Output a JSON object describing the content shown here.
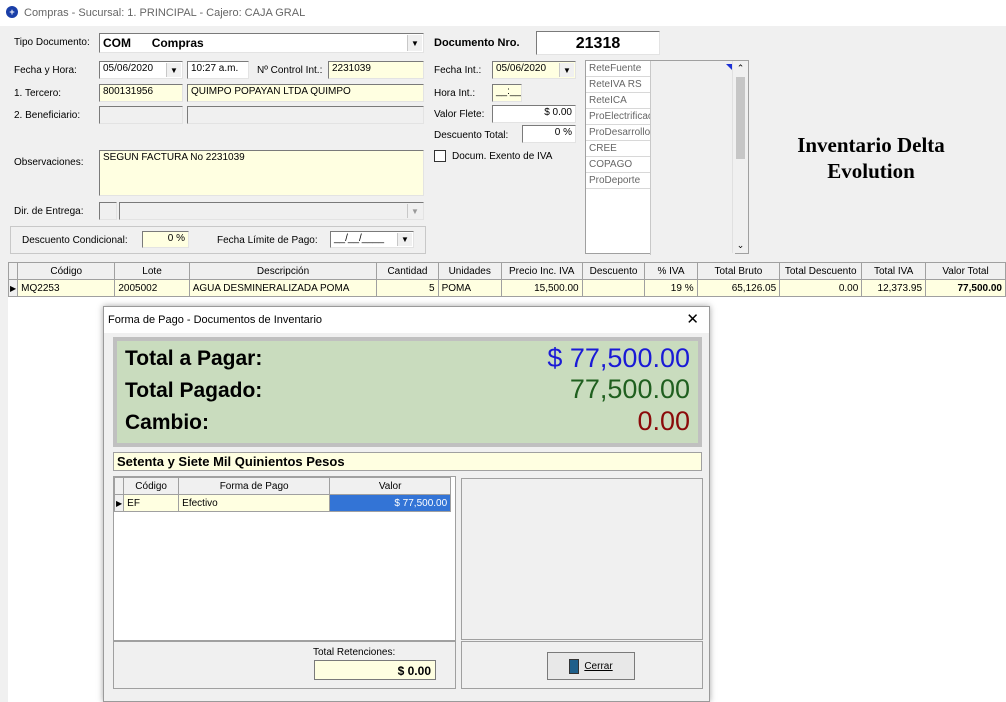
{
  "window": {
    "title": "Compras - Sucursal: 1. PRINCIPAL - Cajero: CAJA GRAL"
  },
  "form": {
    "tipo_documento_label": "Tipo Documento:",
    "tipo_documento_code": "COM",
    "tipo_documento_name": "Compras",
    "documento_nro_label": "Documento Nro.",
    "documento_nro": "21318",
    "fecha_hora_label": "Fecha y Hora:",
    "fecha": "05/06/2020",
    "hora": "10:27 a.m.",
    "control_label": "Nº Control Int.:",
    "control": "2231039",
    "tercero_label": "1. Tercero:",
    "tercero_nit": "800131956",
    "tercero_name": "QUIMPO POPAYAN LTDA QUIMPO",
    "beneficiario_label": "2. Beneficiario:",
    "observaciones_label": "Observaciones:",
    "observaciones": "SEGUN FACTURA No 2231039",
    "dir_entrega_label": "Dir. de Entrega:",
    "descuento_condicional_label": "Descuento Condicional:",
    "descuento_condicional": "0 %",
    "fecha_limite_label": "Fecha Límite de Pago:",
    "fecha_limite": "__/__/____",
    "fecha_int_label": "Fecha Int.:",
    "fecha_int": "05/06/2020",
    "hora_int_label": "Hora Int.:",
    "hora_int": "__:__",
    "valor_flete_label": "Valor Flete:",
    "valor_flete": "$ 0.00",
    "descuento_total_label": "Descuento Total:",
    "descuento_total": "0 %",
    "exento_label": "Docum. Exento de IVA"
  },
  "retenciones": [
    "ReteFuente",
    "ReteIVA RS",
    "ReteICA",
    "ProElectrificaci",
    "ProDesarrollo",
    "CREE",
    "COPAGO",
    "ProDeporte"
  ],
  "brand": {
    "line1": "Inventario Delta",
    "line2": "Evolution"
  },
  "items_grid": {
    "headers": [
      "Código",
      "Lote",
      "Descripción",
      "Cantidad",
      "Unidades",
      "Precio Inc. IVA",
      "Descuento",
      "% IVA",
      "Total Bruto",
      "Total Descuento",
      "Total IVA",
      "Valor Total"
    ],
    "rows": [
      [
        "MQ2253",
        "2005002",
        "AGUA DESMINERALIZADA POMA",
        "5",
        "POMA",
        "15,500.00",
        "",
        "19 %",
        "65,126.05",
        "0.00",
        "12,373.95",
        "77,500.00"
      ]
    ]
  },
  "dialog": {
    "title": "Forma de Pago - Documentos de Inventario",
    "total_pagar_label": "Total a Pagar:",
    "total_pagar": "$ 77,500.00",
    "total_pagado_label": "Total Pagado:",
    "total_pagado": "77,500.00",
    "cambio_label": "Cambio:",
    "cambio": "0.00",
    "en_letras": "Setenta y Siete Mil Quinientos Pesos",
    "pay_headers": [
      "Código",
      "Forma de Pago",
      "Valor"
    ],
    "pay_rows": [
      [
        "EF",
        "Efectivo",
        "$ 77,500.00"
      ]
    ],
    "total_retenciones_label": "Total Retenciones:",
    "total_retenciones": "$ 0.00",
    "cerrar_label": "Cerrar"
  }
}
